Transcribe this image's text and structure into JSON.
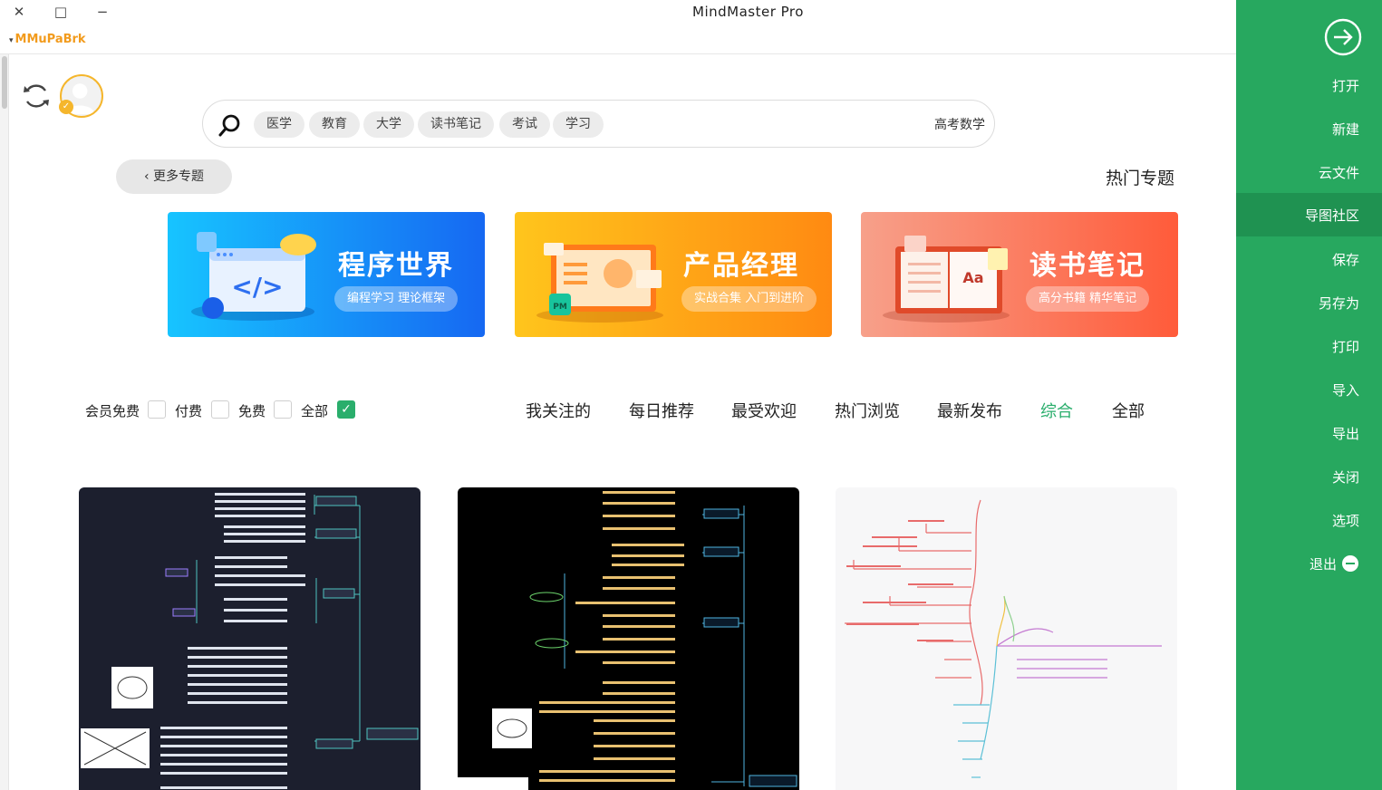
{
  "window": {
    "title": "MindMaster Pro",
    "minimize_label": "−",
    "restore_label": "□",
    "close_label": "✕"
  },
  "account": {
    "name": "MMuPaBrk",
    "caret": "▾"
  },
  "search": {
    "value": "高考数学",
    "chips": [
      "学习",
      "考试",
      "读书笔记",
      "大学",
      "教育",
      "医学"
    ]
  },
  "hot_topics": {
    "title": "热门专题",
    "more_label": "更多专题",
    "banners": [
      {
        "title": "读书笔记",
        "subtitle": "高分书籍 精华笔记",
        "colors": [
          "#f7a08a",
          "#ff5b3a"
        ]
      },
      {
        "title": "产品经理",
        "subtitle": "实战合集 入门到进阶",
        "colors": [
          "#ffc51c",
          "#ff8a12"
        ]
      },
      {
        "title": "程序世界",
        "subtitle": "编程学习 理论框架",
        "colors": [
          "#17c4ff",
          "#1668f2"
        ]
      }
    ]
  },
  "tabs": [
    {
      "label": "全部",
      "active": false
    },
    {
      "label": "综合",
      "active": true
    },
    {
      "label": "最新发布",
      "active": false
    },
    {
      "label": "热门浏览",
      "active": false
    },
    {
      "label": "最受欢迎",
      "active": false
    },
    {
      "label": "每日推荐",
      "active": false
    },
    {
      "label": "我关注的",
      "active": false
    }
  ],
  "filters": [
    {
      "label": "全部",
      "checked": true
    },
    {
      "label": "免费",
      "checked": false
    },
    {
      "label": "付费",
      "checked": false
    },
    {
      "label": "会员免费",
      "checked": false
    }
  ],
  "sidebar": {
    "items": [
      {
        "label": "打开",
        "active": false
      },
      {
        "label": "新建",
        "active": false
      },
      {
        "label": "云文件",
        "active": false
      },
      {
        "label": "导图社区",
        "active": true
      },
      {
        "label": "保存",
        "active": false
      },
      {
        "label": "另存为",
        "active": false
      },
      {
        "label": "打印",
        "active": false
      },
      {
        "label": "导入",
        "active": false
      },
      {
        "label": "导出",
        "active": false
      },
      {
        "label": "关闭",
        "active": false
      },
      {
        "label": "选项",
        "active": false
      },
      {
        "label": "退出",
        "active": false
      }
    ]
  },
  "colors": {
    "brand_green": "#27a85f",
    "active_tab": "#2aae6c",
    "account_orange": "#f29b1d"
  }
}
